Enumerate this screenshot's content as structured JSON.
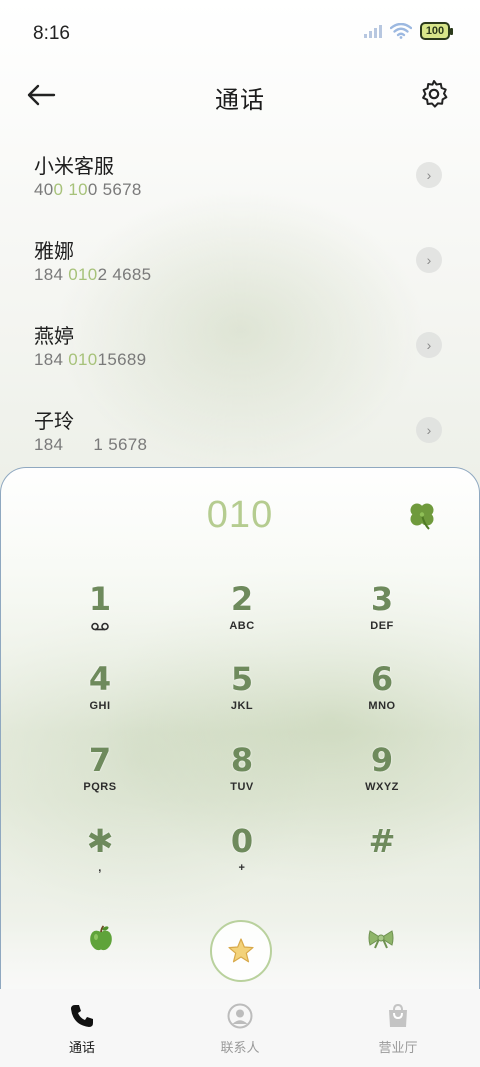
{
  "status_bar": {
    "time": "8:16",
    "battery": "100"
  },
  "header": {
    "title": "通话"
  },
  "contacts": [
    {
      "name": "小米客服",
      "number_parts": [
        "40",
        "0",
        " ",
        "10",
        "0 5678"
      ]
    },
    {
      "name": "雅娜",
      "number_parts": [
        "184 ",
        "010",
        "2 4685",
        "",
        ""
      ]
    },
    {
      "name": "燕婷",
      "number_parts": [
        "184 ",
        "010",
        "15689",
        "",
        ""
      ]
    },
    {
      "name": "子玲",
      "number_parts": [
        "184 ",
        "",
        "     1 5678",
        "",
        ""
      ]
    }
  ],
  "dialpad": {
    "display": "010",
    "keys": [
      {
        "digit": "1",
        "letters": ""
      },
      {
        "digit": "2",
        "letters": "ABC"
      },
      {
        "digit": "3",
        "letters": "DEF"
      },
      {
        "digit": "4",
        "letters": "GHI"
      },
      {
        "digit": "5",
        "letters": "JKL"
      },
      {
        "digit": "6",
        "letters": "MNO"
      },
      {
        "digit": "7",
        "letters": "PQRS"
      },
      {
        "digit": "8",
        "letters": "TUV"
      },
      {
        "digit": "9",
        "letters": "WXYZ"
      },
      {
        "digit": "✱",
        "letters": ","
      },
      {
        "digit": "0",
        "letters": "+"
      },
      {
        "digit": "#",
        "letters": ""
      }
    ]
  },
  "tabs": [
    {
      "label": "通话",
      "active": true
    },
    {
      "label": "联系人",
      "active": false
    },
    {
      "label": "营业厅",
      "active": false
    }
  ],
  "colors": {
    "accent": "#a7c27a",
    "digit": "#6e8a5c",
    "card_border": "#8fa8c0"
  }
}
